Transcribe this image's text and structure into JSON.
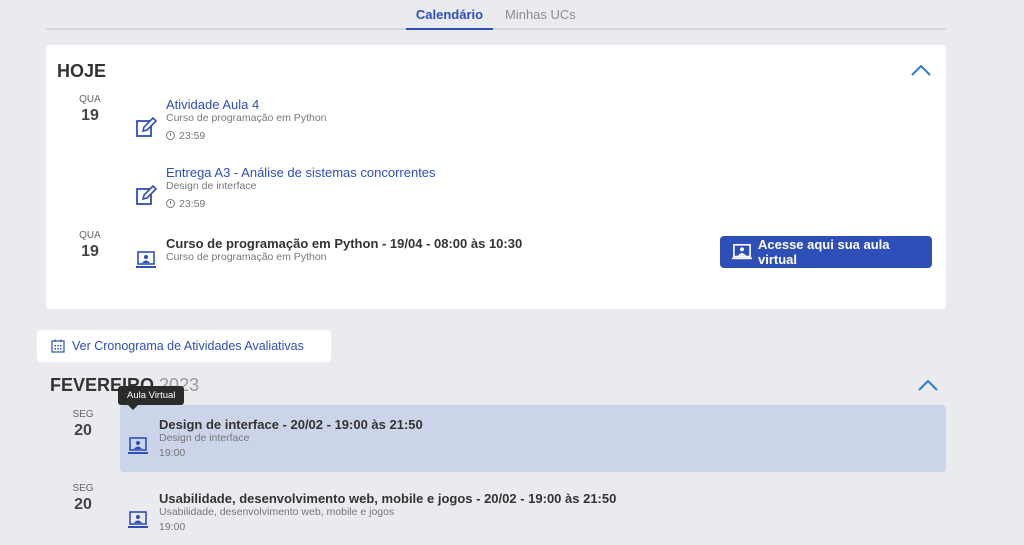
{
  "tabs": [
    {
      "label": "Calendário",
      "active": true
    },
    {
      "label": "Minhas UCs",
      "active": false
    }
  ],
  "today": {
    "title": "HOJE",
    "events": [
      {
        "dow": "QUA",
        "day": "19",
        "title": "Atividade Aula 4",
        "course": "Curso de programação em Python",
        "time": "23:59",
        "icon": "edit-icon"
      },
      {
        "title": "Entrega A3 - Análise de sistemas concorrentes",
        "course": "Design de interface",
        "time": "23:59",
        "icon": "edit-icon"
      },
      {
        "dow": "QUA",
        "day": "19",
        "title": "Curso de programação em Python - 19/04 - 08:00 às 10:30",
        "course": "Curso de programação em Python",
        "icon": "laptop-icon"
      }
    ],
    "virtual_button": "Acesse aqui sua aula virtual"
  },
  "schedule_link": "Ver Cronograma de Atividades Avaliativas",
  "month": {
    "name": "FEVEREIRO",
    "year": "2023",
    "tooltip": "Aula Virtual",
    "events": [
      {
        "dow": "SEG",
        "day": "20",
        "title": "Design de interface - 20/02 - 19:00 às 21:50",
        "course": "Design de interface",
        "time": "19:00",
        "icon": "laptop-icon",
        "highlighted": true
      },
      {
        "dow": "SEG",
        "day": "20",
        "title": "Usabilidade, desenvolvimento web, mobile e jogos - 20/02 - 19:00 às 21:50",
        "course": "Usabilidade, desenvolvimento web, mobile e jogos",
        "time": "19:00",
        "icon": "laptop-icon",
        "highlighted": false
      }
    ]
  },
  "colors": {
    "accent": "#2e4fb8",
    "background": "#eaebee",
    "highlight": "#ccd4e9"
  }
}
